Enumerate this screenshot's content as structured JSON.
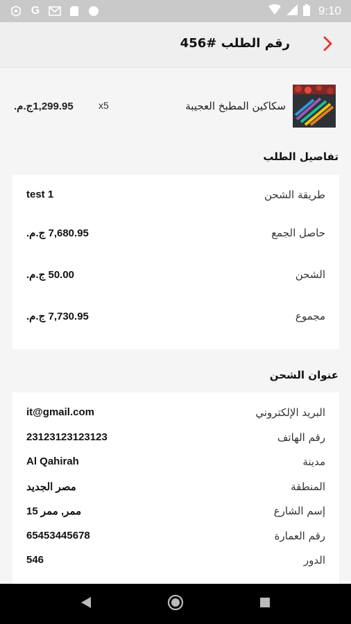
{
  "status_bar": {
    "time": "9:10",
    "left_icons": [
      "android-icon",
      "google-icon",
      "gmail-icon",
      "sim-icon",
      "circle-icon"
    ],
    "right_icons": [
      "wifi-icon",
      "signal-icon",
      "battery-icon"
    ]
  },
  "header": {
    "title": "رقم الطلب #456"
  },
  "product": {
    "name": "سكاكين المطبخ العجيبة",
    "qty": "x5",
    "price": "1,299.95ج.م."
  },
  "order_details": {
    "title": "تفاصيل الطلب",
    "rows": [
      {
        "label": "طريقة الشحن",
        "value": "test 1"
      },
      {
        "label": "حاصل الجمع",
        "value": "7,680.95 ج.م."
      },
      {
        "label": "الشحن",
        "value": "50.00 ج.م."
      },
      {
        "label": "مجموع",
        "value": "7,730.95 ج.م."
      }
    ]
  },
  "shipping_address": {
    "title": "عنوان الشحن",
    "rows": [
      {
        "label": "البريد الإلكتروني",
        "value": "it@gmail.com"
      },
      {
        "label": "رقم الهاتف",
        "value": "23123123123123"
      },
      {
        "label": "مدينة",
        "value": "Al Qahirah"
      },
      {
        "label": "المنطقة",
        "value": "مصر الجديد"
      },
      {
        "label": "إسم الشارع",
        "value": "15 ممر, ممر"
      },
      {
        "label": "رقم العمارة",
        "value": "65453445678"
      },
      {
        "label": "الدور",
        "value": "546"
      }
    ]
  },
  "colors": {
    "accent": "#e53935",
    "background": "#f5f5f5",
    "card": "#ffffff",
    "status_bar": "#c9c9c9",
    "nav_bar": "#000000"
  }
}
